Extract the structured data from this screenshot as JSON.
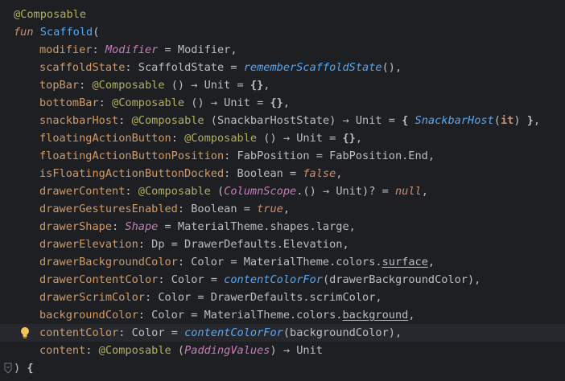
{
  "editor": {
    "lines": [
      {
        "segments": [
          {
            "t": "@Composable",
            "c": "ann"
          }
        ]
      },
      {
        "segments": [
          {
            "t": "fun",
            "c": "kw"
          },
          {
            "t": " ",
            "c": "punct"
          },
          {
            "t": "Scaffold",
            "c": "fn"
          },
          {
            "t": "(",
            "c": "punct"
          }
        ]
      },
      {
        "segments": [
          {
            "t": "modifier",
            "c": "param"
          },
          {
            "t": ": ",
            "c": "punct"
          },
          {
            "t": "Modifier",
            "c": "ti"
          },
          {
            "t": " = Modifier,",
            "c": "punct"
          }
        ]
      },
      {
        "segments": [
          {
            "t": "scaffoldState",
            "c": "param"
          },
          {
            "t": ": ScaffoldState = ",
            "c": "punct"
          },
          {
            "t": "rememberScaffoldState",
            "c": "fni"
          },
          {
            "t": "(),",
            "c": "punct"
          }
        ]
      },
      {
        "segments": [
          {
            "t": "topBar",
            "c": "param"
          },
          {
            "t": ": ",
            "c": "punct"
          },
          {
            "t": "@Composable",
            "c": "ann"
          },
          {
            "t": " () → Unit = ",
            "c": "punct"
          },
          {
            "t": "{}",
            "c": "brace"
          },
          {
            "t": ",",
            "c": "punct"
          }
        ]
      },
      {
        "segments": [
          {
            "t": "bottomBar",
            "c": "param"
          },
          {
            "t": ": ",
            "c": "punct"
          },
          {
            "t": "@Composable",
            "c": "ann"
          },
          {
            "t": " () → Unit = ",
            "c": "punct"
          },
          {
            "t": "{}",
            "c": "brace"
          },
          {
            "t": ",",
            "c": "punct"
          }
        ]
      },
      {
        "segments": [
          {
            "t": "snackbarHost",
            "c": "param"
          },
          {
            "t": ": ",
            "c": "punct"
          },
          {
            "t": "@Composable",
            "c": "ann"
          },
          {
            "t": " (SnackbarHostState) → Unit = ",
            "c": "punct"
          },
          {
            "t": "{",
            "c": "brace"
          },
          {
            "t": " ",
            "c": "punct"
          },
          {
            "t": "SnackbarHost",
            "c": "fni"
          },
          {
            "t": "(",
            "c": "punct"
          },
          {
            "t": "it",
            "c": "itkw"
          },
          {
            "t": ") ",
            "c": "punct"
          },
          {
            "t": "}",
            "c": "brace"
          },
          {
            "t": ",",
            "c": "punct"
          }
        ]
      },
      {
        "segments": [
          {
            "t": "floatingActionButton",
            "c": "param"
          },
          {
            "t": ": ",
            "c": "punct"
          },
          {
            "t": "@Composable",
            "c": "ann"
          },
          {
            "t": " () → Unit = ",
            "c": "punct"
          },
          {
            "t": "{}",
            "c": "brace"
          },
          {
            "t": ",",
            "c": "punct"
          }
        ]
      },
      {
        "segments": [
          {
            "t": "floatingActionButtonPosition",
            "c": "param"
          },
          {
            "t": ": FabPosition = FabPosition.End,",
            "c": "punct"
          }
        ]
      },
      {
        "segments": [
          {
            "t": "isFloatingActionButtonDocked",
            "c": "param"
          },
          {
            "t": ": Boolean = ",
            "c": "punct"
          },
          {
            "t": "false",
            "c": "bool"
          },
          {
            "t": ",",
            "c": "punct"
          }
        ]
      },
      {
        "segments": [
          {
            "t": "drawerContent",
            "c": "param"
          },
          {
            "t": ": ",
            "c": "punct"
          },
          {
            "t": "@Composable",
            "c": "ann"
          },
          {
            "t": " (",
            "c": "punct"
          },
          {
            "t": "ColumnScope",
            "c": "ti"
          },
          {
            "t": ".() → Unit)? = ",
            "c": "punct"
          },
          {
            "t": "null",
            "c": "bool"
          },
          {
            "t": ",",
            "c": "punct"
          }
        ]
      },
      {
        "segments": [
          {
            "t": "drawerGesturesEnabled",
            "c": "param"
          },
          {
            "t": ": Boolean = ",
            "c": "punct"
          },
          {
            "t": "true",
            "c": "bool"
          },
          {
            "t": ",",
            "c": "punct"
          }
        ]
      },
      {
        "segments": [
          {
            "t": "drawerShape",
            "c": "param"
          },
          {
            "t": ": ",
            "c": "punct"
          },
          {
            "t": "Shape",
            "c": "ti"
          },
          {
            "t": " = MaterialTheme.shapes.large,",
            "c": "punct"
          }
        ]
      },
      {
        "segments": [
          {
            "t": "drawerElevation",
            "c": "param"
          },
          {
            "t": ": Dp = DrawerDefaults.Elevation,",
            "c": "punct"
          }
        ]
      },
      {
        "segments": [
          {
            "t": "drawerBackgroundColor",
            "c": "param"
          },
          {
            "t": ": Color = MaterialTheme.colors.",
            "c": "punct"
          },
          {
            "t": "surface",
            "c": "ul"
          },
          {
            "t": ",",
            "c": "punct"
          }
        ]
      },
      {
        "segments": [
          {
            "t": "drawerContentColor",
            "c": "param"
          },
          {
            "t": ": Color = ",
            "c": "punct"
          },
          {
            "t": "contentColorFor",
            "c": "fni"
          },
          {
            "t": "(drawerBackgroundColor),",
            "c": "punct"
          }
        ]
      },
      {
        "segments": [
          {
            "t": "drawerScrimColor",
            "c": "param"
          },
          {
            "t": ": Color = DrawerDefaults.scrimColor,",
            "c": "punct"
          }
        ]
      },
      {
        "segments": [
          {
            "t": "backgroundColor",
            "c": "param"
          },
          {
            "t": ": Color = MaterialTheme.colors.",
            "c": "punct"
          },
          {
            "t": "background",
            "c": "ul"
          },
          {
            "t": ",",
            "c": "punct"
          }
        ]
      },
      {
        "segments": [
          {
            "t": "contentColor",
            "c": "param"
          },
          {
            "t": ": Color = ",
            "c": "punct"
          },
          {
            "t": "contentColorFor",
            "c": "fni"
          },
          {
            "t": "(backgroundColor),",
            "c": "punct"
          }
        ]
      },
      {
        "segments": [
          {
            "t": "content",
            "c": "param"
          },
          {
            "t": ": ",
            "c": "punct"
          },
          {
            "t": "@Composable",
            "c": "ann"
          },
          {
            "t": " (",
            "c": "punct"
          },
          {
            "t": "PaddingValues",
            "c": "ti"
          },
          {
            "t": ") → Unit",
            "c": "punct"
          }
        ]
      },
      {
        "segments": [
          {
            "t": ") ",
            "c": "punct"
          },
          {
            "t": "{",
            "c": "brace"
          }
        ]
      }
    ],
    "current_line": 18,
    "gutter_icons": {
      "intention": "bulb-icon",
      "fold": "fold-icon"
    },
    "colors": {
      "background": "#1e1f22",
      "current_line": "#26282e",
      "annotation": "#b3ae60",
      "keyword": "#cf8e6d",
      "function": "#56a8f5",
      "parameter": "#d19a66",
      "type_italic": "#c77dbb",
      "text": "#bcbec4"
    }
  }
}
